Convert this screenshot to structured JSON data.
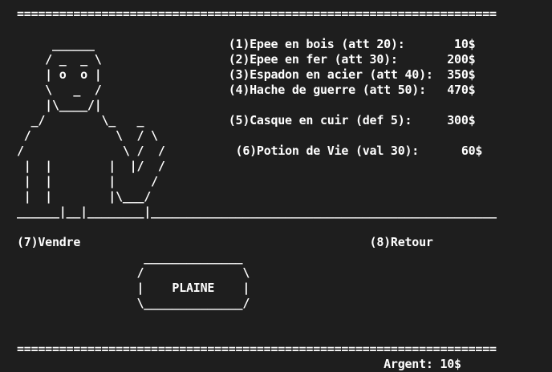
{
  "colors": {
    "background": "#1e1e1e",
    "text": "#ffffff"
  },
  "screen": {
    "top_border": "====================================================================",
    "shopkeeper_art": {
      "row_1": "     ______                ",
      "row_2": "    / _  _ \\               ",
      "row_3": "    | o  o |               ",
      "row_4": "    \\   _  /               ",
      "row_5": "    |\\____/|               ",
      "row_6": "  _/        \\_   _         ",
      "row_7": " /            \\  / \\        ",
      "row_8": "/              \\ /  /        ",
      "row_9": " |  |        |  |/  /        ",
      "row_10": " |  |        |     /        ",
      "row_11": " |  |        |\\___/        "
    },
    "shop_items": [
      {
        "label": "(1)Epee en bois (att 20):       10$"
      },
      {
        "label": "(2)Epee en fer (att 30):       200$"
      },
      {
        "label": "(3)Espadon en acier (att 40):  350$"
      },
      {
        "label": "(4)Hache de guerre (att 50):   470$"
      },
      {
        "label": "(5)Casque en cuir (def 5):     300$"
      },
      {
        "label": "(6)Potion de Vie (val 30):      60$"
      }
    ],
    "counter_line": "______|__|________|_________________________________________________",
    "sell_option": "(7)Vendre",
    "back_option": "(8)Retour",
    "location_box": {
      "top": "______________",
      "upper": "/              \\",
      "label": "PLAINE",
      "lower": "\\______________/"
    },
    "bottom_border": "====================================================================",
    "money": "Argent: 10$"
  }
}
